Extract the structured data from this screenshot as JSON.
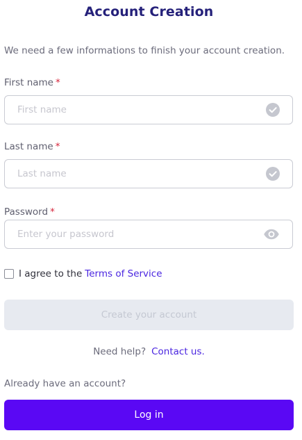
{
  "header": {
    "title": "Account Creation",
    "subtitle": "We need a few informations to finish your account creation."
  },
  "form": {
    "required_marker": "*",
    "first_name": {
      "label": "First name",
      "placeholder": "First name",
      "value": "",
      "icon": "check-circle-icon"
    },
    "last_name": {
      "label": "Last name",
      "placeholder": "Last name",
      "value": "",
      "icon": "check-circle-icon"
    },
    "password": {
      "label": "Password",
      "placeholder": "Enter your password",
      "value": "",
      "icon": "eye-icon"
    },
    "terms": {
      "checked": false,
      "text": "I agree to the",
      "link_text": "Terms of Service"
    },
    "submit_label": "Create your account"
  },
  "help": {
    "text": "Need help?",
    "link_text": "Contact us."
  },
  "login": {
    "prompt": "Already have an account?",
    "button_label": "Log in"
  },
  "colors": {
    "title": "#25217a",
    "accent": "#5a08f4",
    "link": "#4a25e0",
    "required": "#d6243a",
    "disabled_button_bg": "#e7eaf0",
    "icon_gray": "#c5c7cf"
  }
}
